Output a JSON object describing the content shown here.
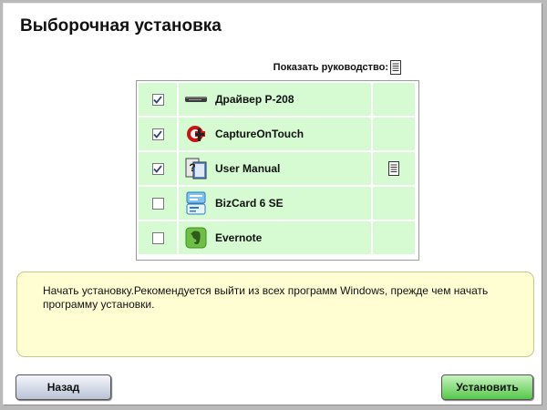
{
  "window": {
    "title": "Выборочная установка"
  },
  "guide_header": {
    "label": "Показать руководство:",
    "icon": "document-icon"
  },
  "components": [
    {
      "name": "Драйвер P-208",
      "checked": true,
      "icon": "scanner-icon",
      "has_guide": false
    },
    {
      "name": "CaptureOnTouch",
      "checked": true,
      "icon": "capture-on-touch-icon",
      "has_guide": false
    },
    {
      "name": "User Manual",
      "checked": true,
      "icon": "manual-icon",
      "has_guide": true
    },
    {
      "name": "BizCard 6 SE",
      "checked": false,
      "icon": "bizcard-icon",
      "has_guide": false
    },
    {
      "name": "Evernote",
      "checked": false,
      "icon": "evernote-icon",
      "has_guide": false
    }
  ],
  "message": {
    "text": "Начать установку.Рекомендуется выйти из всех программ Windows, прежде чем начать программу установки."
  },
  "buttons": {
    "back": "Назад",
    "install": "Установить"
  },
  "colors": {
    "row_background": "#d6fbd2",
    "message_background": "#fffed2",
    "install_button": "#56c84a",
    "back_button": "#b9c2d6"
  }
}
